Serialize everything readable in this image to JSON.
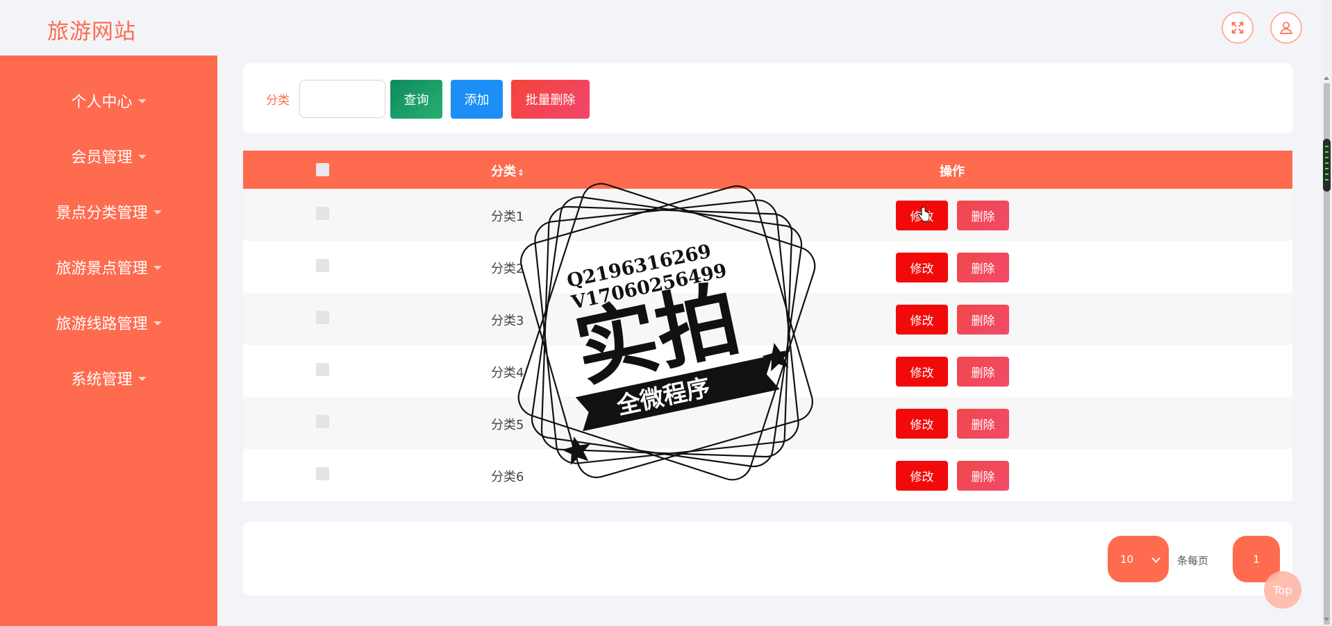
{
  "header": {
    "logo": "旅游网站",
    "fullscreen_icon": "fullscreen-icon",
    "user_icon": "user-icon"
  },
  "sidebar": {
    "items": [
      {
        "label": "个人中心"
      },
      {
        "label": "会员管理"
      },
      {
        "label": "景点分类管理"
      },
      {
        "label": "旅游景点管理"
      },
      {
        "label": "旅游线路管理"
      },
      {
        "label": "系统管理"
      }
    ]
  },
  "search": {
    "label": "分类",
    "value": "",
    "query_label": "查询",
    "add_label": "添加",
    "batch_delete_label": "批量删除"
  },
  "table": {
    "headers": {
      "category": "分类",
      "sort_icon": "⇕",
      "operation": "操作"
    },
    "rows": [
      {
        "category": "分类1",
        "edit": "修改",
        "delete": "删除"
      },
      {
        "category": "分类2",
        "edit": "修改",
        "delete": "删除"
      },
      {
        "category": "分类3",
        "edit": "修改",
        "delete": "删除"
      },
      {
        "category": "分类4",
        "edit": "修改",
        "delete": "删除"
      },
      {
        "category": "分类5",
        "edit": "修改",
        "delete": "删除"
      },
      {
        "category": "分类6",
        "edit": "修改",
        "delete": "删除"
      }
    ]
  },
  "pagination": {
    "page_size": "10",
    "per_page_label": "条每页",
    "current_page": "1"
  },
  "back_to_top": "Top",
  "watermark": {
    "line1": "Q2196316269",
    "line2": "V17060256499",
    "main": "实拍",
    "banner": "全微程序"
  },
  "colors": {
    "primary": "#ff6b4f",
    "edit": "#f20a0a",
    "query": "#0f8a5f",
    "add": "#1b8ff5"
  }
}
